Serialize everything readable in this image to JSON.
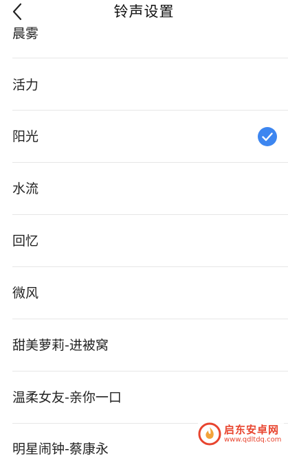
{
  "header": {
    "title": "铃声设置",
    "back_icon": "chevron-left-icon"
  },
  "ringtones": [
    {
      "label": "晨雾",
      "selected": false
    },
    {
      "label": "活力",
      "selected": false
    },
    {
      "label": "阳光",
      "selected": true
    },
    {
      "label": "水流",
      "selected": false
    },
    {
      "label": "回忆",
      "selected": false
    },
    {
      "label": "微风",
      "selected": false
    },
    {
      "label": "甜美萝莉-进被窝",
      "selected": false
    },
    {
      "label": "温柔女友-亲你一口",
      "selected": false
    },
    {
      "label": "明星闹钟-蔡康永",
      "selected": false
    }
  ],
  "check_icon": "check-circle-icon",
  "colors": {
    "accent": "#3d86f0",
    "divider": "#e6e6e6",
    "watermark": "#e8442e"
  },
  "watermark": {
    "name": "启东安卓网",
    "url": "www.qdltdq.com",
    "logo_icon": "flame-logo-icon"
  }
}
